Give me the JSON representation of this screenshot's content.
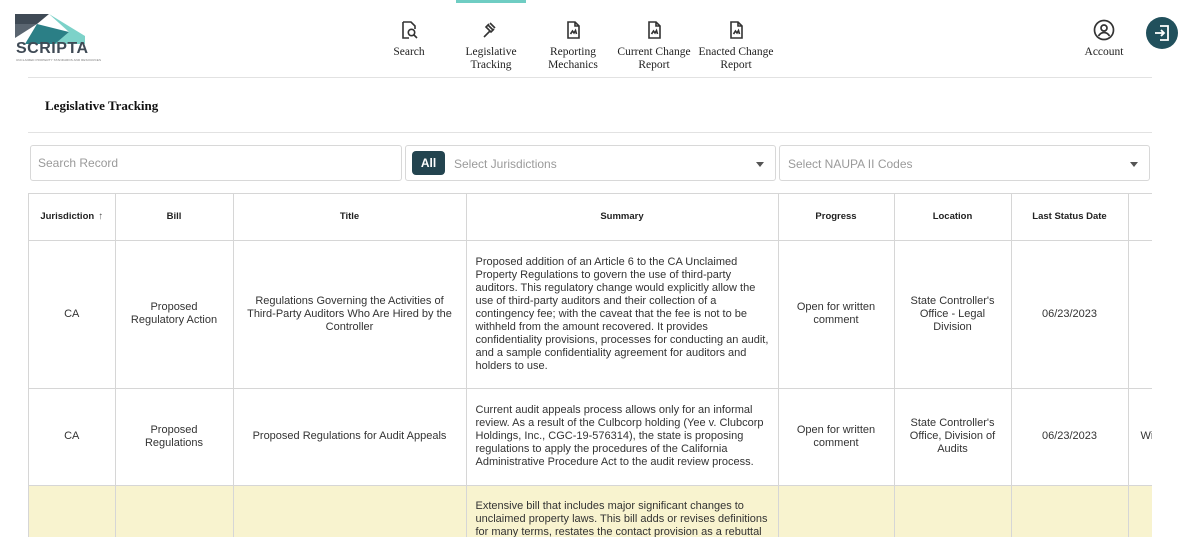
{
  "brand": {
    "name": "SCRIPTA",
    "tagline": "UNCLAIMED PROPERTY STANDARDS AND RESOURCES",
    "accent": "#6fcdc3",
    "dark": "#21505c"
  },
  "nav": {
    "items": [
      {
        "label": "Search",
        "icon": "search-document-icon"
      },
      {
        "label": "Legislative Tracking",
        "icon": "gavel-icon",
        "active": true
      },
      {
        "label": "Reporting Mechanics",
        "icon": "document-icon"
      },
      {
        "label": "Current Change Report",
        "icon": "document-icon"
      },
      {
        "label": "Enacted Change Report",
        "icon": "document-icon"
      }
    ],
    "account_label": "Account"
  },
  "page": {
    "title": "Legislative Tracking"
  },
  "filters": {
    "search_placeholder": "Search Record",
    "all_chip": "All",
    "jurisdictions_placeholder": "Select Jurisdictions",
    "naupa_placeholder": "Select NAUPA II Codes"
  },
  "table": {
    "columns": [
      "Jurisdiction",
      "Bill",
      "Title",
      "Summary",
      "Progress",
      "Location",
      "Last Status Date"
    ],
    "sort_icon": "arrow-up-icon",
    "rows": [
      {
        "jurisdiction": "CA",
        "bill": "Proposed Regulatory Action",
        "title": "Regulations Governing the Activities of Third-Party Auditors Who Are Hired by the Controller",
        "summary": "Proposed addition of an Article 6 to the CA Unclaimed Property Regulations to govern the use of third-party auditors. This regulatory change would explicitly allow the use of third-party auditors and their collection of a contingency fee; with the caveat that the fee is not to be withheld from the amount recovered. It provides confidentiality provisions, processes for conducting an audit, and a sample confidentiality agreement for auditors and holders to use.",
        "progress": "Open for written comment",
        "location": "State Controller's Office - Legal Division",
        "date": "06/23/2023",
        "extra": ""
      },
      {
        "jurisdiction": "CA",
        "bill": "Proposed Regulations",
        "title": "Proposed Regulations for Audit Appeals",
        "summary": "Current audit appeals process allows only for an informal review. As a result of the Culbcorp holding (Yee v. Clubcorp Holdings, Inc., CGC-19-576314), the state is proposing regulations to apply the procedures of the California Administrative Procedure Act to the audit review process.",
        "progress": "Open for written comment",
        "location": "State Controller's Office, Division of Audits",
        "date": "06/23/2023",
        "extra": "Wi"
      },
      {
        "jurisdiction": "",
        "bill": "",
        "title": "",
        "summary": "Extensive bill that includes major significant changes to unclaimed property laws. This bill adds or revises definitions for many terms, restates the contact provision as a rebuttal",
        "progress": "",
        "location": "",
        "date": "",
        "extra": ""
      }
    ]
  }
}
